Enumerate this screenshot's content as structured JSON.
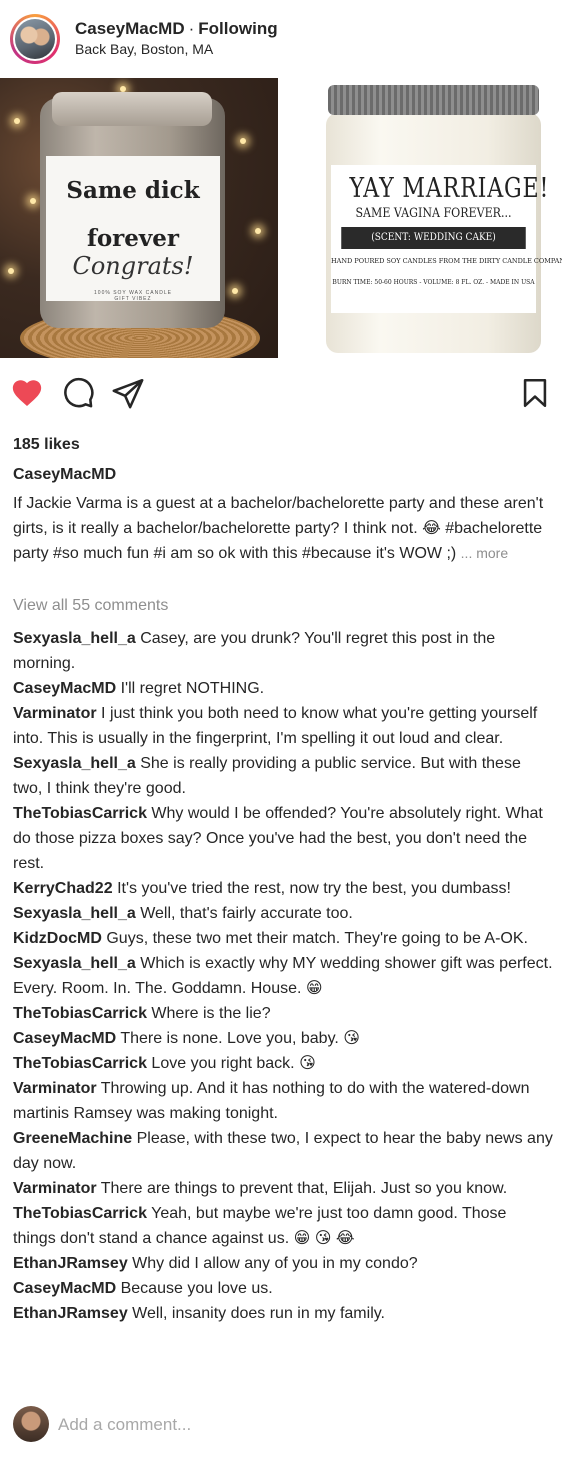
{
  "header": {
    "username": "CaseyMacMD",
    "separator": "·",
    "follow_status": "Following",
    "location": "Back Bay, Boston, MA"
  },
  "photos": {
    "left_label": {
      "line1": "Same dick",
      "line2": "forever",
      "line3": "Congrats!",
      "line4": "100% SOY WAX CANDLE",
      "line5": "GIFT VIBEZ"
    },
    "right_label": {
      "line1": "YAY MARRIAGE!",
      "line2": "SAME VAGINA FOREVER...",
      "line3": "(SCENT: WEDDING CAKE)",
      "line4": "HAND POURED SOY CANDLES FROM THE DIRTY CANDLE COMPANY",
      "line5": "BURN TIME: 50-60 HOURS - VOLUME: 8 FL. OZ. - MADE IN USA"
    }
  },
  "actions": {
    "liked": true,
    "like_color": "#ed4956"
  },
  "post": {
    "likes": "185 likes",
    "caption_user": "CaseyMacMD",
    "caption_text": "If Jackie Varma is a guest at a bachelor/bachelorette party and these aren't girts, is it really a bachelor/bachelorette party? I think not. 😂 #bachelorette party #so much fun #i am so ok with this #because it's WOW ;)",
    "more": "... more",
    "view_all": "View all 55 comments"
  },
  "comments": [
    {
      "user": "Sexyasla_hell_a",
      "text": "Casey, are you drunk? You'll regret this post in the morning."
    },
    {
      "user": "CaseyMacMD",
      "text": "I'll regret NOTHING."
    },
    {
      "user": "Varminator",
      "text": "I just think you both need to know what you're getting yourself into. This is usually in the fingerprint, I'm spelling it out loud and clear."
    },
    {
      "user": "Sexyasla_hell_a",
      "text": "She is really providing a public service. But with these two, I think they're good."
    },
    {
      "user": "TheTobiasCarrick",
      "text": "Why would I be offended? You're absolutely right. What do those pizza boxes say? Once you've had the best, you don't need the rest."
    },
    {
      "user": "KerryChad22",
      "text": "It's you've tried the rest, now try the best, you dumbass!"
    },
    {
      "user": "Sexyasla_hell_a",
      "text": "Well, that's fairly accurate too."
    },
    {
      "user": "KidzDocMD",
      "text": "Guys, these two met their match. They're going to be A-OK."
    },
    {
      "user": "Sexyasla_hell_a",
      "text": "Which is exactly why MY wedding shower gift was perfect. Every. Room. In. The. Goddamn. House. 😁"
    },
    {
      "user": "TheTobiasCarrick",
      "text": "Where is the lie?"
    },
    {
      "user": "CaseyMacMD",
      "text": "There is none. Love you, baby. 😘"
    },
    {
      "user": "TheTobiasCarrick",
      "text": "Love you right back. 😘"
    },
    {
      "user": "Varminator",
      "text": "Throwing up. And it has nothing to do with the watered-down martinis Ramsey was making tonight."
    },
    {
      "user": "GreeneMachine",
      "text": "Please, with these two, I expect to hear the baby news any day now."
    },
    {
      "user": "Varminator",
      "text": "There are things to prevent that, Elijah. Just so you know."
    },
    {
      "user": "TheTobiasCarrick",
      "text": "Yeah, but maybe we're just too damn good. Those things don't stand a chance against us. 😁 😘 😂"
    },
    {
      "user": "EthanJRamsey",
      "text": "Why did I allow any of you in my condo?"
    },
    {
      "user": "CaseyMacMD",
      "text": "Because you love us."
    },
    {
      "user": "EthanJRamsey",
      "text": "Well, insanity does run in my family."
    }
  ],
  "add_comment": {
    "placeholder": "Add a comment..."
  }
}
